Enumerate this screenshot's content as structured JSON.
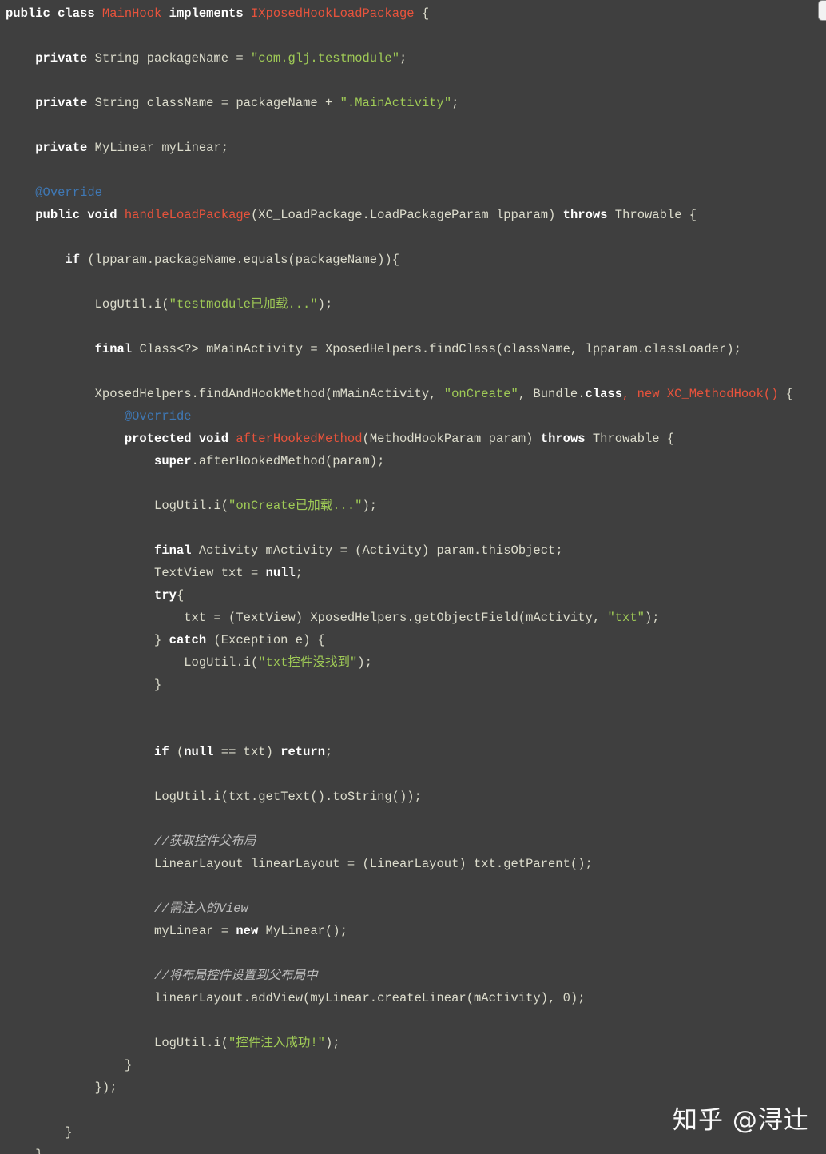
{
  "code_lines": [
    [
      [
        "kw",
        "public class "
      ],
      [
        "nm",
        "MainHook"
      ],
      [
        "kw",
        " implements "
      ],
      [
        "nm",
        "IXposedHookLoadPackage"
      ],
      [
        "txt",
        " {"
      ]
    ],
    [],
    [
      [
        "txt",
        "    "
      ],
      [
        "kw",
        "private"
      ],
      [
        "txt",
        " String packageName = "
      ],
      [
        "str",
        "\"com.glj.testmodule\""
      ],
      [
        "txt",
        ";"
      ]
    ],
    [],
    [
      [
        "txt",
        "    "
      ],
      [
        "kw",
        "private"
      ],
      [
        "txt",
        " String className = packageName + "
      ],
      [
        "str",
        "\".MainActivity\""
      ],
      [
        "txt",
        ";"
      ]
    ],
    [],
    [
      [
        "txt",
        "    "
      ],
      [
        "kw",
        "private"
      ],
      [
        "txt",
        " MyLinear myLinear;"
      ]
    ],
    [],
    [
      [
        "txt",
        "    "
      ],
      [
        "ann",
        "@Override"
      ]
    ],
    [
      [
        "txt",
        "    "
      ],
      [
        "kw",
        "public void"
      ],
      [
        "txt",
        " "
      ],
      [
        "nm",
        "handleLoadPackage"
      ],
      [
        "txt",
        "(XC_LoadPackage.LoadPackageParam lpparam) "
      ],
      [
        "kw",
        "throws"
      ],
      [
        "txt",
        " Throwable {"
      ]
    ],
    [],
    [
      [
        "txt",
        "        "
      ],
      [
        "kw",
        "if"
      ],
      [
        "txt",
        " (lpparam.packageName.equals(packageName)){"
      ]
    ],
    [],
    [
      [
        "txt",
        "            LogUtil.i("
      ],
      [
        "str",
        "\"testmodule已加载...\""
      ],
      [
        "txt",
        ");"
      ]
    ],
    [],
    [
      [
        "txt",
        "            "
      ],
      [
        "kw",
        "final"
      ],
      [
        "txt",
        " Class<?> mMainActivity = XposedHelpers.findClass(className, lpparam.classLoader);"
      ]
    ],
    [],
    [
      [
        "txt",
        "            XposedHelpers.findAndHookMethod(mMainActivity, "
      ],
      [
        "str",
        "\"onCreate\""
      ],
      [
        "txt",
        ", Bundle."
      ],
      [
        "kw",
        "class"
      ],
      [
        "nm",
        ", new XC_MethodHook()"
      ],
      [
        "txt",
        " {"
      ]
    ],
    [
      [
        "txt",
        "                "
      ],
      [
        "ann",
        "@Override"
      ]
    ],
    [
      [
        "txt",
        "                "
      ],
      [
        "kw",
        "protected void"
      ],
      [
        "txt",
        " "
      ],
      [
        "nm",
        "afterHookedMethod"
      ],
      [
        "txt",
        "(MethodHookParam param) "
      ],
      [
        "kw",
        "throws"
      ],
      [
        "txt",
        " Throwable {"
      ]
    ],
    [
      [
        "txt",
        "                    "
      ],
      [
        "kw",
        "super"
      ],
      [
        "txt",
        ".afterHookedMethod(param);"
      ]
    ],
    [],
    [
      [
        "txt",
        "                    LogUtil.i("
      ],
      [
        "str",
        "\"onCreate已加载...\""
      ],
      [
        "txt",
        ");"
      ]
    ],
    [],
    [
      [
        "txt",
        "                    "
      ],
      [
        "kw",
        "final"
      ],
      [
        "txt",
        " Activity mActivity = (Activity) param.thisObject;"
      ]
    ],
    [
      [
        "txt",
        "                    TextView txt = "
      ],
      [
        "kw",
        "null"
      ],
      [
        "txt",
        ";"
      ]
    ],
    [
      [
        "txt",
        "                    "
      ],
      [
        "kw",
        "try"
      ],
      [
        "txt",
        "{"
      ]
    ],
    [
      [
        "txt",
        "                        txt = (TextView) XposedHelpers.getObjectField(mActivity, "
      ],
      [
        "str",
        "\"txt\""
      ],
      [
        "txt",
        ");"
      ]
    ],
    [
      [
        "txt",
        "                    } "
      ],
      [
        "kw",
        "catch"
      ],
      [
        "txt",
        " (Exception e) {"
      ]
    ],
    [
      [
        "txt",
        "                        LogUtil.i("
      ],
      [
        "str",
        "\"txt控件没找到\""
      ],
      [
        "txt",
        ");"
      ]
    ],
    [
      [
        "txt",
        "                    }"
      ]
    ],
    [],
    [],
    [
      [
        "txt",
        "                    "
      ],
      [
        "kw",
        "if"
      ],
      [
        "txt",
        " ("
      ],
      [
        "kw",
        "null"
      ],
      [
        "txt",
        " == txt) "
      ],
      [
        "kw",
        "return"
      ],
      [
        "txt",
        ";"
      ]
    ],
    [],
    [
      [
        "txt",
        "                    LogUtil.i(txt.getText().toString());"
      ]
    ],
    [],
    [
      [
        "txt",
        "                    "
      ],
      [
        "cmt",
        "//获取控件父布局"
      ]
    ],
    [
      [
        "txt",
        "                    LinearLayout linearLayout = (LinearLayout) txt.getParent();"
      ]
    ],
    [],
    [
      [
        "txt",
        "                    "
      ],
      [
        "cmt",
        "//需注入的View"
      ]
    ],
    [
      [
        "txt",
        "                    myLinear = "
      ],
      [
        "kw",
        "new"
      ],
      [
        "txt",
        " MyLinear();"
      ]
    ],
    [],
    [
      [
        "txt",
        "                    "
      ],
      [
        "cmt",
        "//将布局控件设置到父布局中"
      ]
    ],
    [
      [
        "txt",
        "                    linearLayout.addView(myLinear.createLinear(mActivity), 0);"
      ]
    ],
    [],
    [
      [
        "txt",
        "                    LogUtil.i("
      ],
      [
        "str",
        "\"控件注入成功!\""
      ],
      [
        "txt",
        ");"
      ]
    ],
    [
      [
        "txt",
        "                }"
      ]
    ],
    [
      [
        "txt",
        "            });"
      ]
    ],
    [],
    [
      [
        "txt",
        "        }"
      ]
    ],
    [
      [
        "txt",
        "    }"
      ]
    ]
  ],
  "watermark": "知乎 @浔辻",
  "colors": {
    "background": "#3f3f3f",
    "keyword": "#ffffff",
    "declaration_name": "#e8533c",
    "string": "#9fca56",
    "annotation": "#3f78b5",
    "comment": "#bdbdbd",
    "plain": "#dcdccc"
  }
}
